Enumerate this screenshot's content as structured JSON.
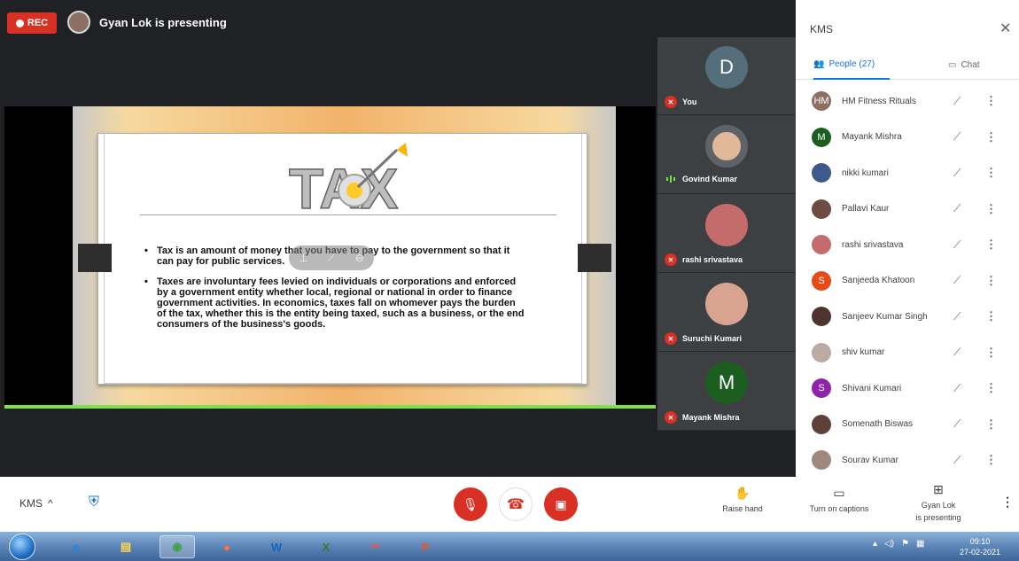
{
  "recording": {
    "label": "REC"
  },
  "presenter": {
    "text": "Gyan Lok is presenting"
  },
  "slide": {
    "logo_text": "TAX",
    "bullets": [
      "Tax is an amount of money that you have to pay to the government so that it can pay for public services.",
      "Taxes are involuntary fees levied on individuals or corporations and enforced by a government entity whether local, regional or national in order to finance government activities. In economics, taxes fall on whomever pays the burden of the tax, whether this is the entity being taxed, such as a business, or the end consumers of the business's goods."
    ]
  },
  "filmstrip": [
    {
      "name": "You",
      "initial": "D",
      "color": "#546e7a",
      "status": "muted"
    },
    {
      "name": "Govind Kumar",
      "initial": "",
      "color": "#e0b89a",
      "status": "speaking"
    },
    {
      "name": "rashi srivastava",
      "initial": "",
      "color": "#c46b6b",
      "status": "muted"
    },
    {
      "name": "Suruchi Kumari",
      "initial": "",
      "color": "#d8a490",
      "status": "muted"
    },
    {
      "name": "Mayank Mishra",
      "initial": "M",
      "color": "#1b5e20",
      "status": "muted"
    }
  ],
  "panel": {
    "title": "KMS",
    "tab_people": "People (27)",
    "tab_chat": "Chat",
    "people": [
      {
        "name": "HM Fitness Rituals",
        "initial": "HM",
        "color": "#8d6e63"
      },
      {
        "name": "Mayank Mishra",
        "initial": "M",
        "color": "#1b5e20"
      },
      {
        "name": "nikki kumari",
        "initial": "",
        "color": "#3e5a8a"
      },
      {
        "name": "Pallavi Kaur",
        "initial": "",
        "color": "#6d4c41"
      },
      {
        "name": "rashi srivastava",
        "initial": "",
        "color": "#c46b6b"
      },
      {
        "name": "Sanjeeda Khatoon",
        "initial": "S",
        "color": "#e64a19"
      },
      {
        "name": "Sanjeev Kumar Singh",
        "initial": "",
        "color": "#4e342e"
      },
      {
        "name": "shiv kumar",
        "initial": "",
        "color": "#bcaaa4"
      },
      {
        "name": "Shivani Kumari",
        "initial": "S",
        "color": "#8e24aa"
      },
      {
        "name": "Somenath Biswas",
        "initial": "",
        "color": "#5d4037"
      },
      {
        "name": "Sourav Kumar",
        "initial": "",
        "color": "#a1887f"
      }
    ]
  },
  "controls": {
    "meeting_name": "KMS",
    "raise_hand": "Raise hand",
    "captions": "Turn on captions",
    "present_line1": "Gyan Lok",
    "present_line2": "is presenting"
  },
  "taskbar": {
    "time": "09:10",
    "date": "27-02-2021"
  }
}
